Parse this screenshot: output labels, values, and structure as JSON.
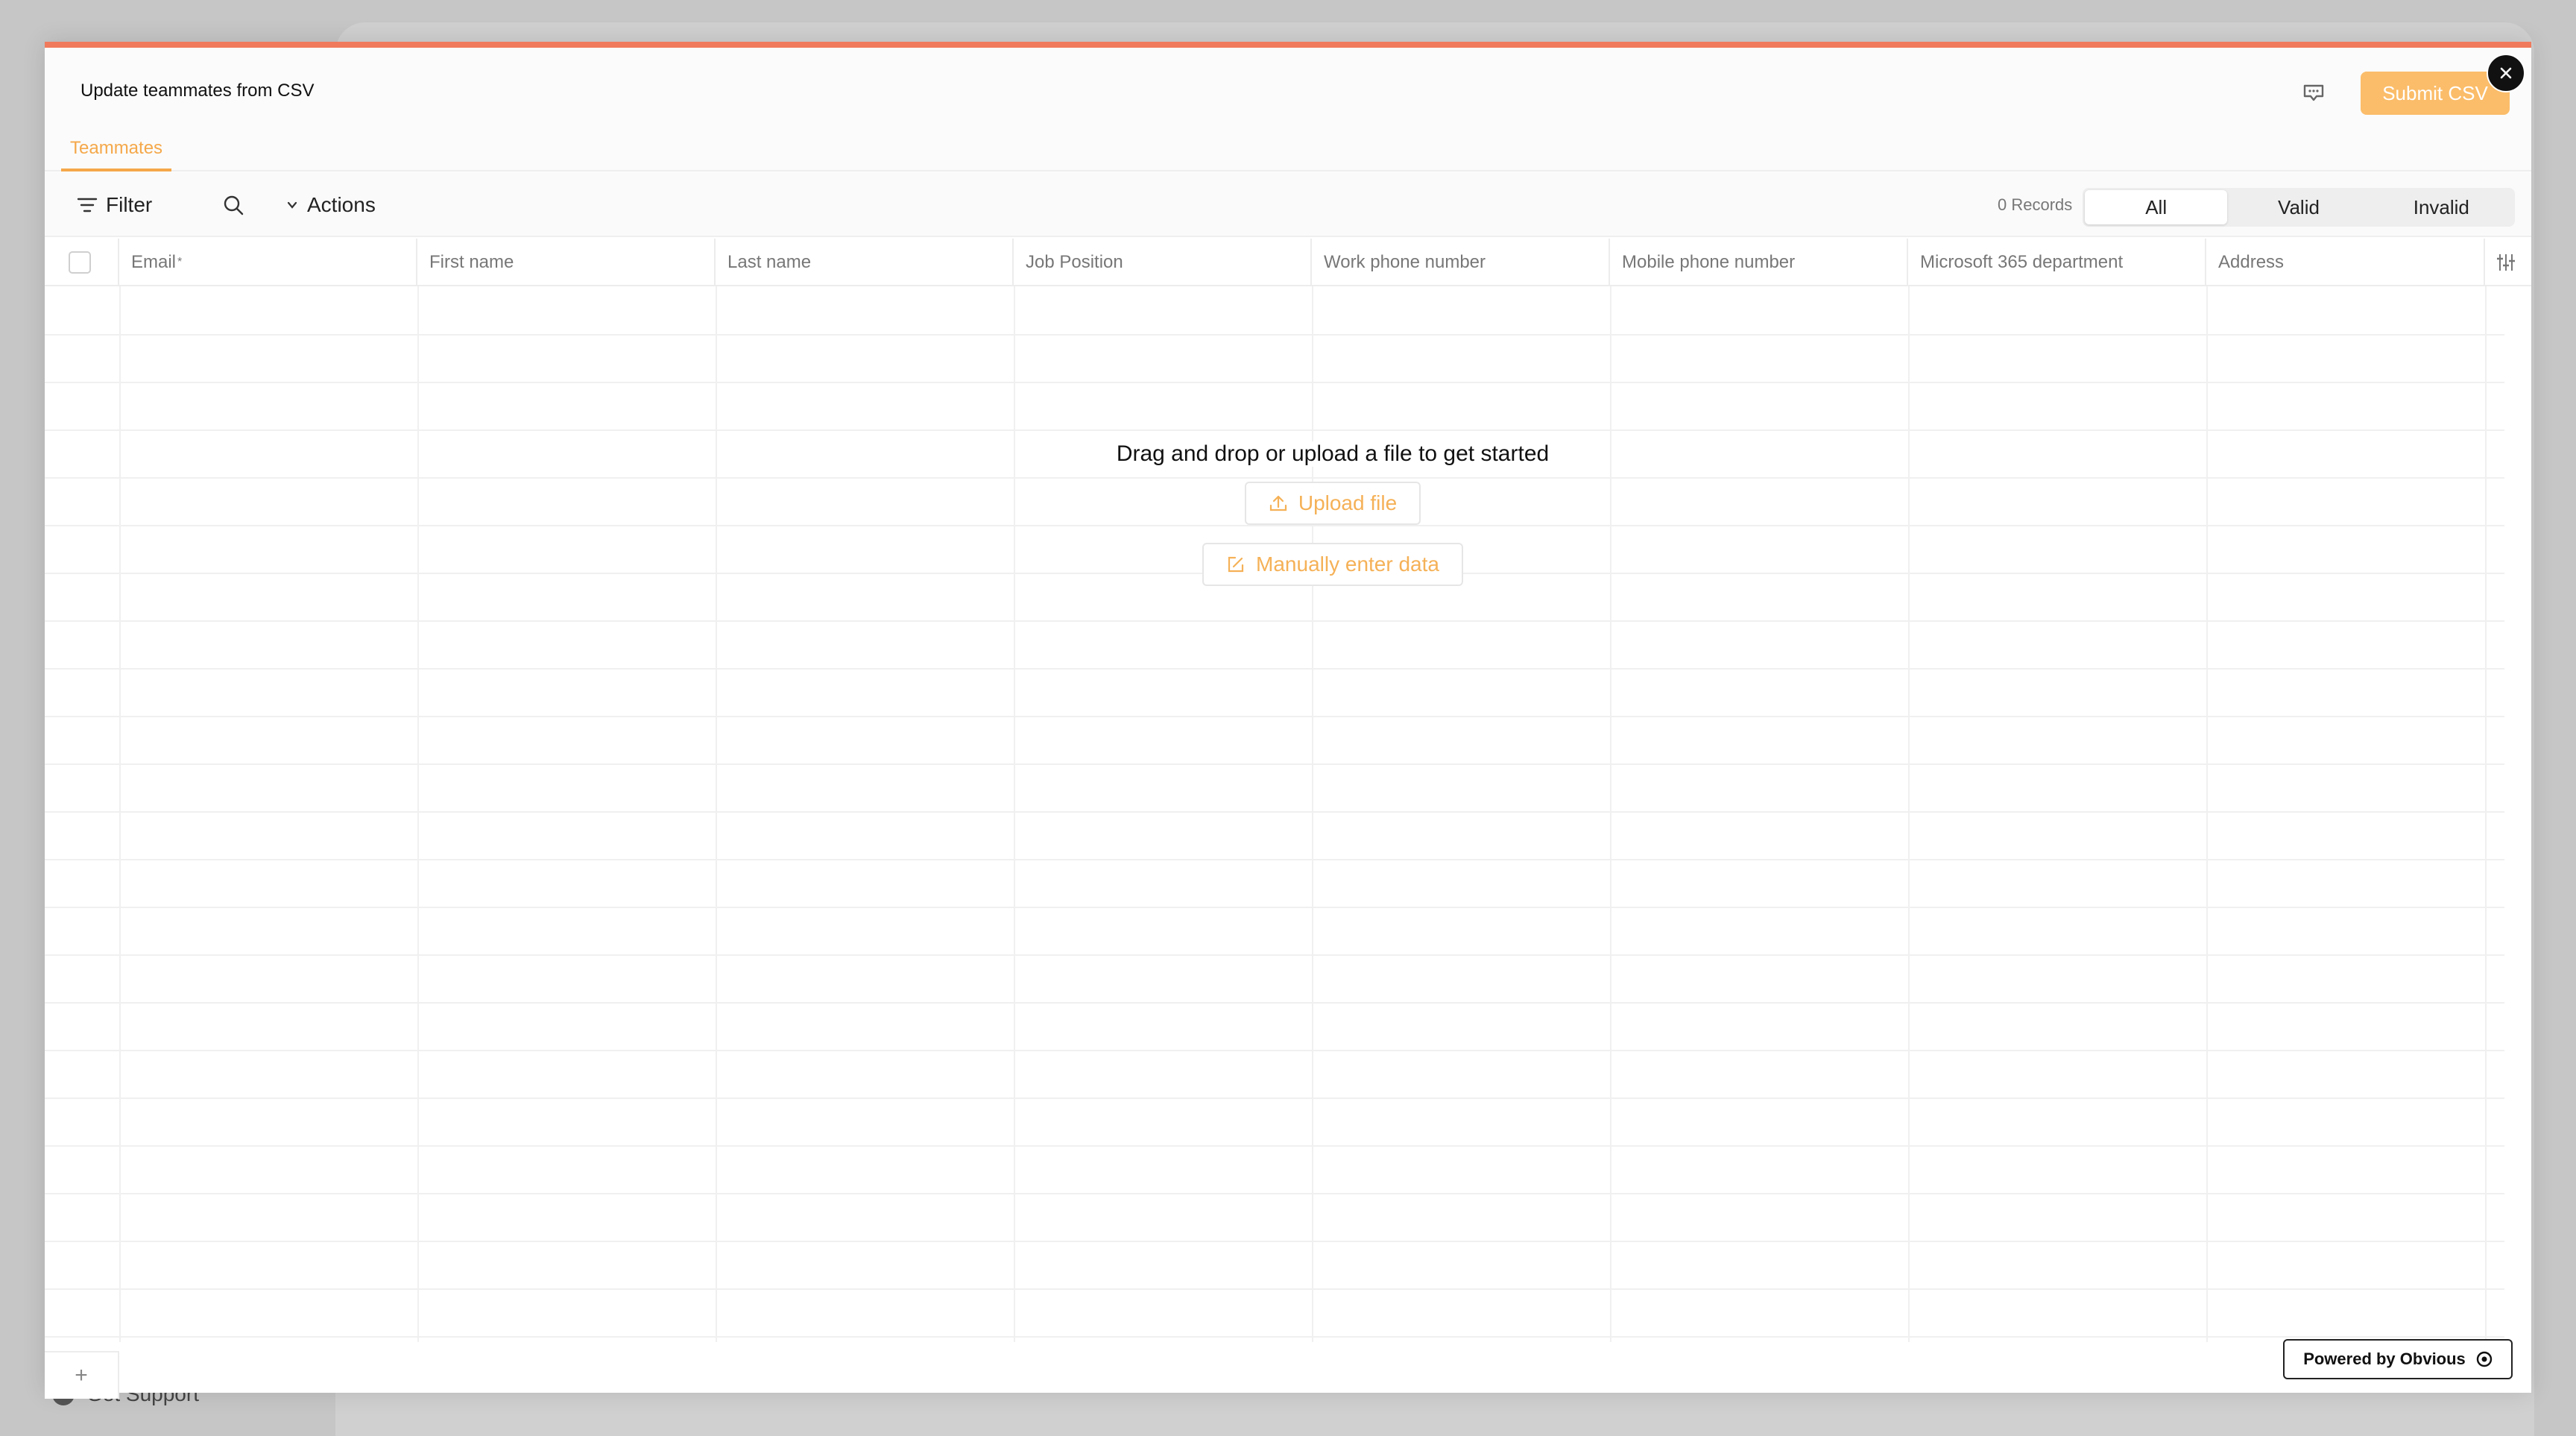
{
  "background": {
    "support_label": "Get Support"
  },
  "modal": {
    "title": "Update teammates from CSV",
    "submit_label": "Submit CSV",
    "tab_label": "Teammates"
  },
  "toolbar": {
    "filter_label": "Filter",
    "actions_label": "Actions",
    "records_label": "0 Records",
    "segments": [
      "All",
      "Valid",
      "Invalid"
    ],
    "active_segment": "All"
  },
  "table": {
    "columns": [
      "Email",
      "First name",
      "Last name",
      "Job Position",
      "Work phone number",
      "Mobile phone number",
      "Microsoft 365 department",
      "Address"
    ],
    "required_marker": "*"
  },
  "empty_state": {
    "message": "Drag and drop or upload a file to get started",
    "upload_label": "Upload file",
    "manual_label": "Manually enter data"
  },
  "footer": {
    "add_row_label": "+",
    "powered_label": "Powered by Obvious"
  },
  "colors": {
    "accent": "#f5a84a",
    "top_bar": "#f07a5c",
    "submit_bg": "#fbbd6a"
  },
  "icons": [
    "chevron-down-icon",
    "help-icon",
    "close-icon",
    "filter-icon",
    "search-icon",
    "upload-icon",
    "edit-icon",
    "column-settings-icon",
    "obvious-logo-icon",
    "question-icon"
  ]
}
